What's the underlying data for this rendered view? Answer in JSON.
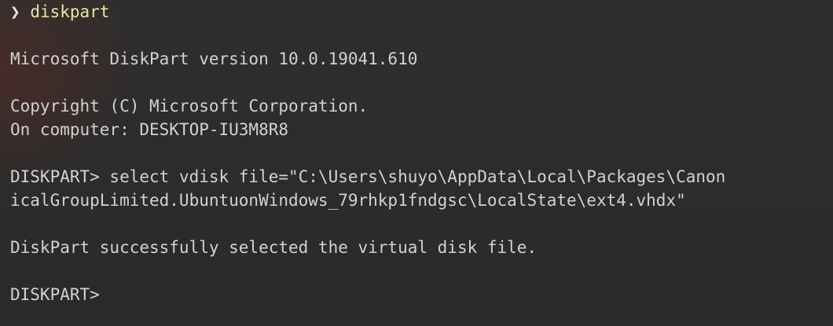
{
  "shell_prompt": {
    "symbol": "❯",
    "command": "diskpart"
  },
  "lines": [
    "",
    "Microsoft DiskPart version 10.0.19041.610",
    "",
    "Copyright (C) Microsoft Corporation.",
    "On computer: DESKTOP-IU3M8R8",
    "",
    "DISKPART> select vdisk file=\"C:\\Users\\shuyo\\AppData\\Local\\Packages\\Canon",
    "icalGroupLimited.UbuntuonWindows_79rhkp1fndgsc\\LocalState\\ext4.vhdx\"",
    "",
    "DiskPart successfully selected the virtual disk file.",
    "",
    "DISKPART>"
  ],
  "colors": {
    "background": "#2c2c2c",
    "text": "#d2d2d2",
    "command": "#e9e6a6"
  }
}
